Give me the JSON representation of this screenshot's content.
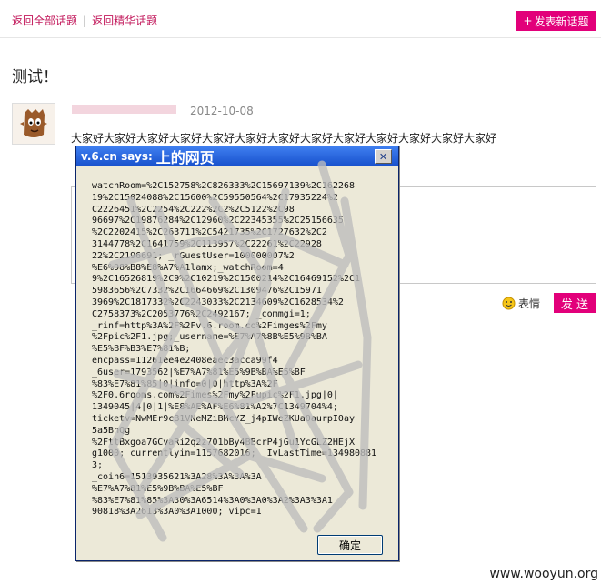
{
  "nav": {
    "all_topics": "返回全部话题",
    "separator": "|",
    "featured_topics": "返回精华话题",
    "new_topic_plus": "+",
    "new_topic_label": "发表新话题"
  },
  "topic": {
    "title": "测试！",
    "date": "2012-10-08",
    "content": "大家好大家好大家好大家好大家好大家好大家好大家好大家好大家好大家好大家好大家好"
  },
  "reply": {
    "emoji_label": "表情",
    "send_label": "发 送"
  },
  "dialog": {
    "title_prefix": "v.6.cn says:",
    "title_suffix": "上的网页",
    "close_symbol": "✕",
    "message": "watchRoom=%2C152758%2C826333%2C15697139%2C162268\n19%2C15024088%2C15600%2C59550564%2C17935224%2\nC2226451%2C2254%2C222%2C2%2C5122%2C98\n96697%2C19876284%2C12960%2C22345355%2C25156635\n%2C2202415%2C263711%2C5421735%2C1727632%2C2\n3144778%2C1641759%2C113957%2C22261%2C22928\n22%2C2196691; _rGuestUser=100000007%2\n%E6%98%B8%E8%A7%A1lamx;_watchRoom=4\n9%2C16526819%2C9%2C10219%2C1500214%2C16469152%2C1\n5983656%2C7332%2C1664669%2C1309476%2C15971\n3969%2C1817332%2C2243033%2C2134609%2C1628534%2\nC2758373%2C2053776%2C2492167; _commgi=1;\n_rinf=http%3A%2F%2Fv.6.room.co%2Fimges%2Fmy\n%2Fpic%2F1.jpg;_username=%E7%A7%8B%E5%9B%BA\n%E5%BF%B3%E7%81%B;\nencpass=11261ee4e2408eaec3acca99f4\n_6user=1793562|%E7%A7%81%E5%9B%BA%E5%BF\n%83%E7%81%85|0|info=0|0|http%3A%2F\n%2F0.6rooms.com%2Fimes%2Fmy%2Fupic%2F1.jpg|0|\n1349045|4|0|1|%E8%AE%AF%E6%81%A2%7C1349704%4;\nticketv=NwMEr9cB1VNeMZiBMcYZ_j4pIWeZKUa0aurpI0ay\n5a5BhQg\n%2FttBxgoa7GCvaRi2q2z701bBy4BBcrP4jGu1YcGLZ2HEjX\ng1000; currentlyin=1157682016; _IvLastTime=1349808813;\n_coin6=1513935621%3A28%3A%3A%3A\n%E7%A7%81%E5%9B%BA%E5%BF\n%83%E7%81%85%3A30%3A6514%3A0%3A0%3A2%3A3%3A1\n90818%3A2613%3A0%3A1000; vipc=1",
    "ok_label": "确定"
  },
  "watermark": "www.wooyun.org"
}
